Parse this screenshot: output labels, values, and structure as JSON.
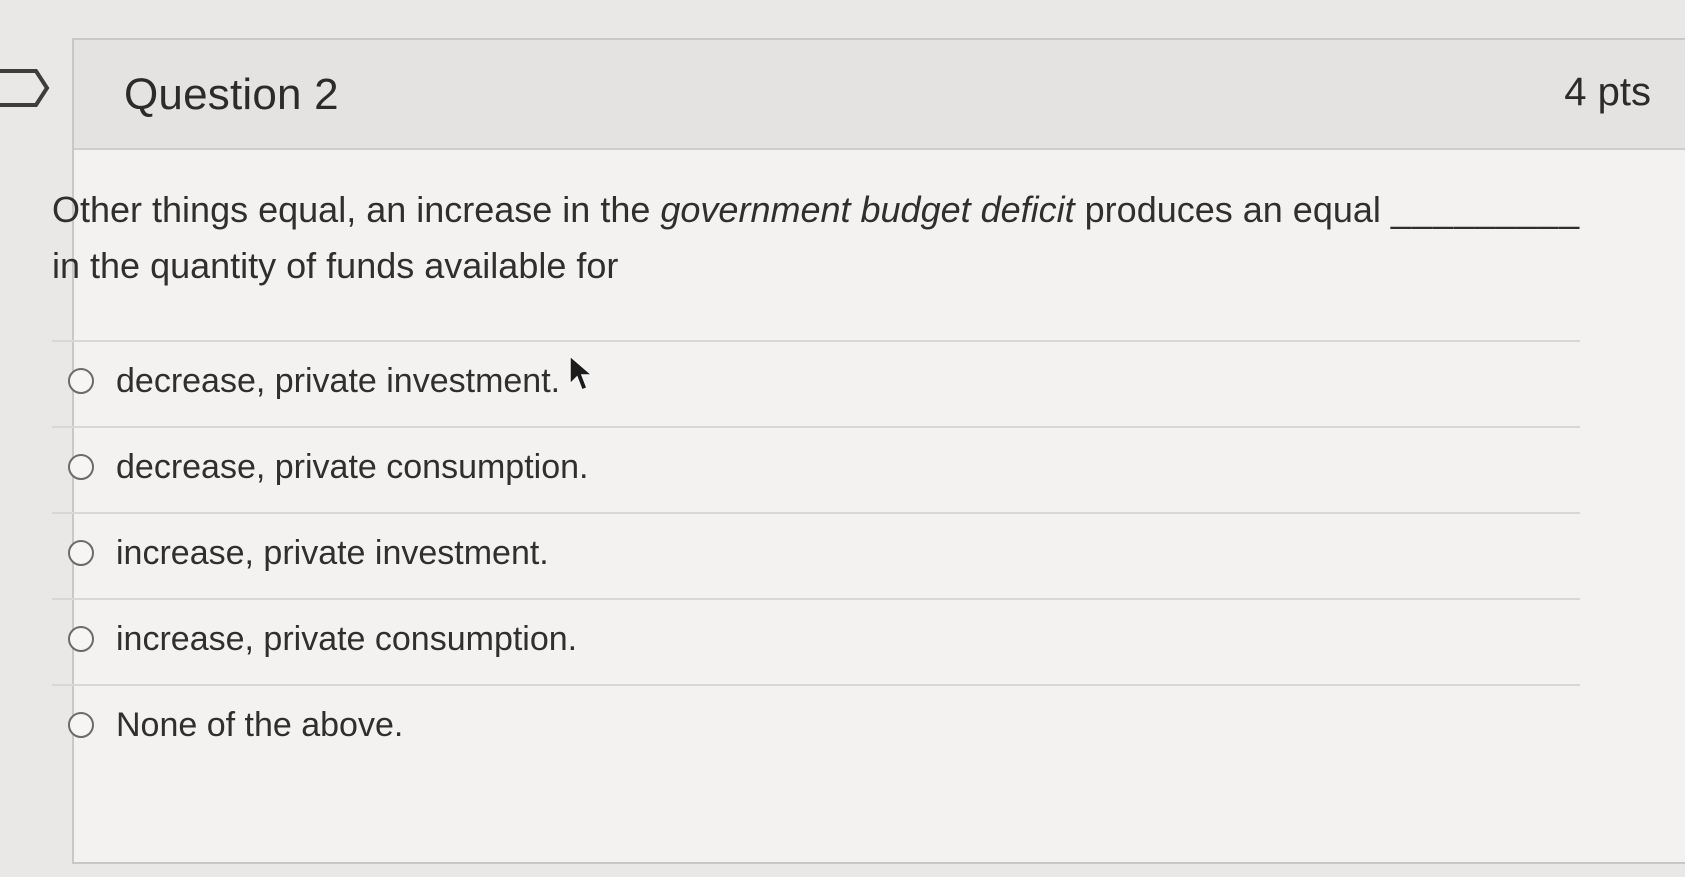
{
  "question": {
    "title": "Question 2",
    "points": "4 pts",
    "text_before": "Other things equal, an increase in the ",
    "text_emphasis": "government budget deficit",
    "text_after": " produces an equal ",
    "blank": "_________",
    "text_line2": "in the quantity of funds available for"
  },
  "answers": [
    {
      "label": "decrease, private investment."
    },
    {
      "label": "decrease, private consumption."
    },
    {
      "label": "increase, private investment."
    },
    {
      "label": "increase, private consumption."
    },
    {
      "label": "None of the above."
    }
  ],
  "colors": {
    "background": "#e9e8e6",
    "card": "#f3f2f0",
    "header": "#e4e3e1",
    "text": "#2f2f2f"
  }
}
